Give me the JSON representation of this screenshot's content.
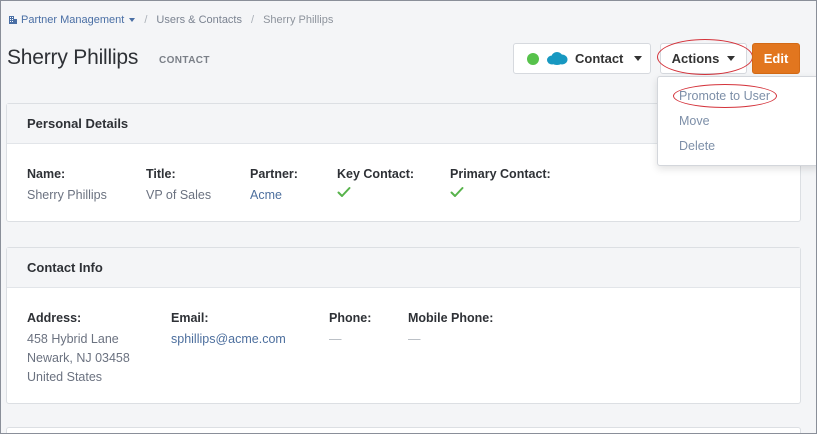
{
  "breadcrumb": {
    "root": "Partner Management",
    "level2": "Users & Contacts",
    "current": "Sherry Phillips"
  },
  "header": {
    "title": "Sherry Phillips",
    "record_type": "CONTACT",
    "sync_status_color": "#57c24b",
    "crm_icon": "salesforce-cloud-icon",
    "contact_label": "Contact",
    "actions_label": "Actions",
    "edit_label": "Edit"
  },
  "actions_menu": {
    "items": [
      "Promote to User",
      "Move",
      "Delete"
    ]
  },
  "personal_details": {
    "heading": "Personal Details",
    "name_label": "Name:",
    "name_value": "Sherry Phillips",
    "title_label": "Title:",
    "title_value": "VP of Sales",
    "partner_label": "Partner:",
    "partner_value": "Acme",
    "key_contact_label": "Key Contact:",
    "key_contact_checked": true,
    "primary_contact_label": "Primary Contact:",
    "primary_contact_checked": true
  },
  "contact_info": {
    "heading": "Contact Info",
    "address_label": "Address:",
    "address_lines": [
      "458 Hybrid Lane",
      "Newark, NJ 03458",
      "United States"
    ],
    "email_label": "Email:",
    "email_value": "sphillips@acme.com",
    "phone_label": "Phone:",
    "phone_value": "—",
    "mobile_label": "Mobile Phone:",
    "mobile_value": "—"
  },
  "colors": {
    "accent": "#e2761f",
    "link": "#4d6f9e",
    "check": "#57b34b",
    "highlight_ring": "#d4323a"
  }
}
